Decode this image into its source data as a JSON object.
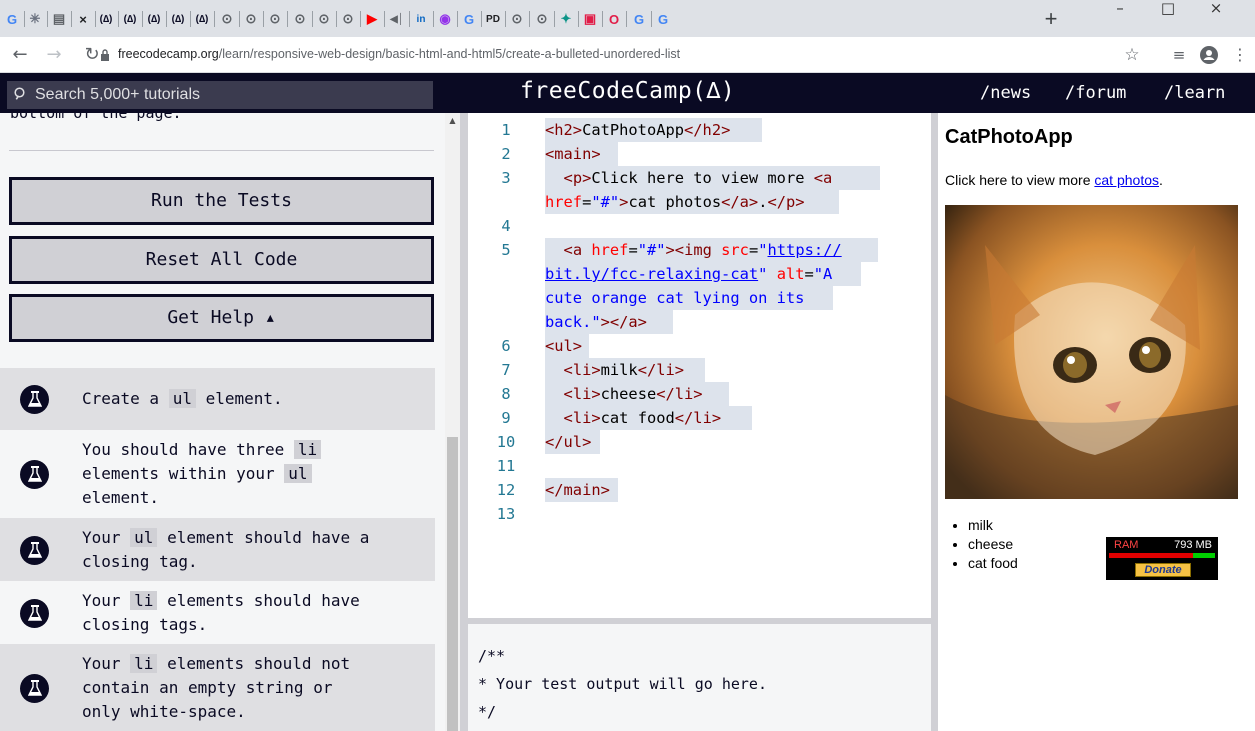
{
  "browser": {
    "tabs": [
      {
        "glyph": "G",
        "color": "#4285f4",
        "icon": "google-icon"
      },
      {
        "glyph": "✳",
        "color": "#6b7280",
        "icon": "app-icon"
      },
      {
        "glyph": "▤",
        "color": "#5f6368",
        "icon": "tab-list-icon"
      },
      {
        "glyph": "×",
        "color": "#202124",
        "icon": "close-tab-icon"
      },
      {
        "glyph": "(∆)",
        "color": "#0a0a23",
        "icon": "freecodecamp-icon"
      },
      {
        "glyph": "(∆)",
        "color": "#0a0a23",
        "icon": "freecodecamp-icon"
      },
      {
        "glyph": "(∆)",
        "color": "#0a0a23",
        "icon": "freecodecamp-icon"
      },
      {
        "glyph": "(∆)",
        "color": "#0a0a23",
        "icon": "freecodecamp-icon"
      },
      {
        "glyph": "(∆)",
        "color": "#0a0a23",
        "icon": "freecodecamp-icon"
      },
      {
        "glyph": "⊙",
        "color": "#5f6368",
        "icon": "globe-icon"
      },
      {
        "glyph": "⊙",
        "color": "#5f6368",
        "icon": "globe-icon"
      },
      {
        "glyph": "⊙",
        "color": "#5f6368",
        "icon": "globe-icon"
      },
      {
        "glyph": "⊙",
        "color": "#5f6368",
        "icon": "globe-icon"
      },
      {
        "glyph": "⊙",
        "color": "#5f6368",
        "icon": "globe-icon"
      },
      {
        "glyph": "⊙",
        "color": "#5f6368",
        "icon": "globe-icon"
      },
      {
        "glyph": "▶",
        "color": "#ff0000",
        "icon": "youtube-icon"
      },
      {
        "glyph": "◀│",
        "color": "#5f6368",
        "icon": "audio-icon"
      },
      {
        "glyph": "in",
        "color": "#0a66c2",
        "icon": "linkedin-icon"
      },
      {
        "glyph": "◉",
        "color": "#9333ea",
        "icon": "podcasts-icon"
      },
      {
        "glyph": "G",
        "color": "#4285f4",
        "icon": "google-icon"
      },
      {
        "glyph": "PD",
        "color": "#202124",
        "icon": "pd-icon"
      },
      {
        "glyph": "⊙",
        "color": "#5f6368",
        "icon": "globe-icon"
      },
      {
        "glyph": "⊙",
        "color": "#5f6368",
        "icon": "globe-icon"
      },
      {
        "glyph": "✦",
        "color": "#0d9488",
        "icon": "extension-icon"
      },
      {
        "glyph": "▣",
        "color": "#e11d48",
        "icon": "opera-box-icon"
      },
      {
        "glyph": "O",
        "color": "#e11d48",
        "icon": "opera-icon"
      },
      {
        "glyph": "G",
        "color": "#4285f4",
        "icon": "google-icon"
      },
      {
        "glyph": "G",
        "color": "#4285f4",
        "icon": "google-icon"
      }
    ],
    "new_tab": "+",
    "window_controls": {
      "minimize": "–",
      "maximize": "□",
      "close": "×"
    },
    "url_domain": "freecodecamp.org",
    "url_path": "/learn/responsive-web-design/basic-html-and-html5/create-a-bulleted-unordered-list"
  },
  "fcc_nav": {
    "search_placeholder": "Search 5,000+ tutorials",
    "logo": "freeCodeCamp(∆)",
    "links": [
      "/news",
      "/forum",
      "/learn"
    ]
  },
  "left_panel": {
    "cut_text": "bottom of the page.",
    "buttons": [
      "Run the Tests",
      "Reset All Code",
      "Get Help ▴"
    ],
    "tests": [
      {
        "lines": [
          [
            "Create a ",
            {
              "code": "ul"
            },
            " element."
          ]
        ]
      },
      {
        "lines": [
          [
            "You should have three ",
            {
              "code": "li"
            }
          ],
          [
            "elements within your ",
            {
              "code": "ul"
            }
          ],
          [
            "element."
          ]
        ]
      },
      {
        "lines": [
          [
            "Your ",
            {
              "code": "ul"
            },
            " element should have a"
          ],
          [
            "closing tag."
          ]
        ]
      },
      {
        "lines": [
          [
            "Your ",
            {
              "code": "li"
            },
            " elements should have"
          ],
          [
            "closing tags."
          ]
        ]
      },
      {
        "lines": [
          [
            "Your ",
            {
              "code": "li"
            },
            " elements should not"
          ],
          [
            "contain an empty string or"
          ],
          [
            "only white-space."
          ]
        ]
      }
    ]
  },
  "editor": {
    "line_numbers": [
      "1",
      "2",
      "3",
      "",
      "4",
      "5",
      "",
      "",
      "",
      "6",
      "7",
      "8",
      "9",
      "10",
      "11",
      "12",
      "13"
    ],
    "lines": [
      [
        [
          "tag",
          "<h2>"
        ],
        [
          "txt",
          "CatPhotoApp"
        ],
        [
          "tag",
          "</h2>"
        ]
      ],
      [
        [
          "tag",
          "<main>"
        ]
      ],
      [
        [
          "txt",
          "  "
        ],
        [
          "tag",
          "<p>"
        ],
        [
          "txt",
          "Click here to view more "
        ],
        [
          "tag",
          "<a"
        ]
      ],
      [
        [
          "attr",
          "href"
        ],
        [
          "txt",
          "="
        ],
        [
          "str",
          "\"#\""
        ],
        [
          "tag",
          ">"
        ],
        [
          "txt",
          "cat photos"
        ],
        [
          "tag",
          "</a>"
        ],
        [
          "txt",
          "."
        ],
        [
          "tag",
          "</p>"
        ]
      ],
      [],
      [
        [
          "txt",
          "  "
        ],
        [
          "tag",
          "<a "
        ],
        [
          "attr",
          "href"
        ],
        [
          "txt",
          "="
        ],
        [
          "str",
          "\"#\""
        ],
        [
          "tag",
          "><img "
        ],
        [
          "attr",
          "src"
        ],
        [
          "txt",
          "="
        ],
        [
          "str",
          "\""
        ],
        [
          "url",
          "https://"
        ]
      ],
      [
        [
          "url",
          "bit.ly/fcc-relaxing-cat"
        ],
        [
          "str",
          "\""
        ],
        [
          "txt",
          " "
        ],
        [
          "attr",
          "alt"
        ],
        [
          "txt",
          "="
        ],
        [
          "str",
          "\"A"
        ]
      ],
      [
        [
          "str",
          "cute orange cat lying on its"
        ]
      ],
      [
        [
          "str",
          "back.\""
        ],
        [
          "tag",
          "></a>"
        ]
      ],
      [
        [
          "tag",
          "<ul>"
        ]
      ],
      [
        [
          "txt",
          "  "
        ],
        [
          "tag",
          "<li>"
        ],
        [
          "txt",
          "milk"
        ],
        [
          "tag",
          "</li>"
        ]
      ],
      [
        [
          "txt",
          "  "
        ],
        [
          "tag",
          "<li>"
        ],
        [
          "txt",
          "cheese"
        ],
        [
          "tag",
          "</li>"
        ]
      ],
      [
        [
          "txt",
          "  "
        ],
        [
          "tag",
          "<li>"
        ],
        [
          "txt",
          "cat food"
        ],
        [
          "tag",
          "</li>"
        ]
      ],
      [
        [
          "tag",
          "</ul>"
        ]
      ],
      [],
      [
        [
          "tag",
          "</main>"
        ]
      ],
      []
    ],
    "output": [
      "/**",
      "* Your test output will go here.",
      "*/"
    ]
  },
  "preview": {
    "heading": "CatPhotoApp",
    "paragraph_prefix": "Click here to view more ",
    "paragraph_link": "cat photos",
    "paragraph_suffix": ".",
    "list": [
      "milk",
      "cheese",
      "cat food"
    ],
    "ram_label": "RAM",
    "ram_value": "793 MB",
    "donate": "Donate"
  }
}
